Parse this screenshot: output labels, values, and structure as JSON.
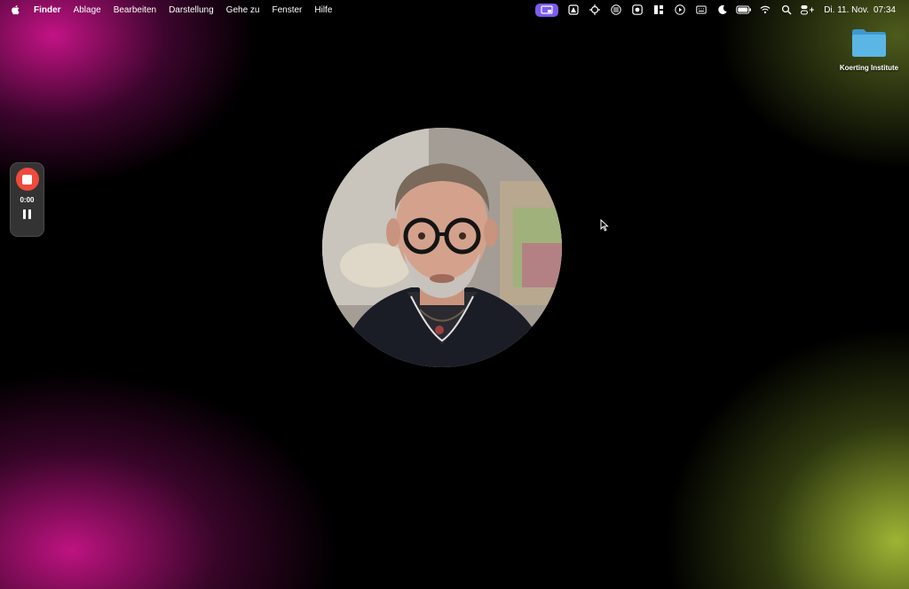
{
  "menubar": {
    "app": "Finder",
    "items": [
      "Ablage",
      "Bearbeiten",
      "Darstellung",
      "Gehe zu",
      "Fenster",
      "Hilfe"
    ],
    "status_icons": [
      "screen-record-icon",
      "drive-icon",
      "crosshair-icon",
      "grid-icon",
      "camera-icon",
      "widgets-icon",
      "play-icon",
      "keyboard-icon",
      "moon-icon",
      "battery-icon",
      "wifi-icon",
      "search-icon",
      "control-center-icon"
    ],
    "date": "Di. 11. Nov.",
    "time": "07:34"
  },
  "desktop": {
    "folder_label": "Koerting Institute"
  },
  "recorder": {
    "timer": "0:00",
    "accent": "#ef4a3c"
  },
  "colors": {
    "active_status": "#7b5cf0",
    "folder": "#5bb6e6"
  }
}
